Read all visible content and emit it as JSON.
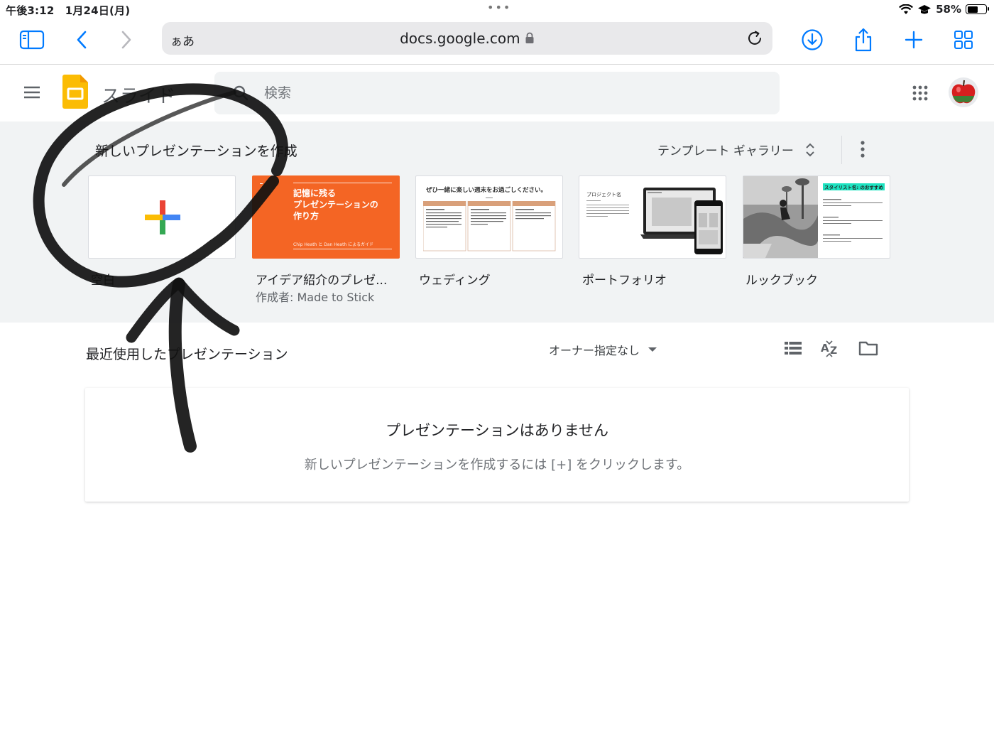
{
  "status_bar": {
    "time": "午後3:12　1月24日(月)",
    "battery_text": "58%",
    "battery_level": 0.58
  },
  "browser": {
    "aa_label": "ぁあ",
    "url": "docs.google.com",
    "icons": [
      "sidebar-icon",
      "back-icon",
      "forward-icon",
      "lock-icon",
      "reload-icon",
      "download-icon",
      "share-icon",
      "new-tab-icon",
      "tabs-icon"
    ]
  },
  "app": {
    "name": "スライド",
    "search_placeholder": "検索"
  },
  "templates": {
    "section_title": "新しいプレゼンテーションを作成",
    "gallery_label": "テンプレート ギャラリー",
    "items": [
      {
        "label": "空白",
        "sub": ""
      },
      {
        "label": "アイデア紹介のプレゼ...",
        "sub": "作成者: Made to Stick",
        "thumb_title": "記憶に残る\nプレゼンテーションの\n作り方",
        "thumb_footer": "Chip Heath と Dan Heath によるガイド"
      },
      {
        "label": "ウェディング",
        "sub": "",
        "thumb_title": "ぜひ一緒に楽しい週末をお過ごしください。"
      },
      {
        "label": "ポートフォリオ",
        "sub": "",
        "thumb_title": "プロジェクト名"
      },
      {
        "label": "ルックブック",
        "sub": "",
        "thumb_title": "スタイリスト名: のおすすめ"
      }
    ]
  },
  "recent": {
    "title": "最近使用したプレゼンテーション",
    "owner_filter": "オーナー指定なし",
    "empty_title": "プレゼンテーションはありません",
    "empty_sub": "新しいプレゼンテーションを作成するには [+] をクリックします。"
  },
  "colors": {
    "accent_blue": "#1a73e8",
    "safari_blue": "#007aff",
    "slides_yellow": "#fbbc04",
    "template_orange": "#f46524",
    "section_gray": "#f1f3f4"
  }
}
